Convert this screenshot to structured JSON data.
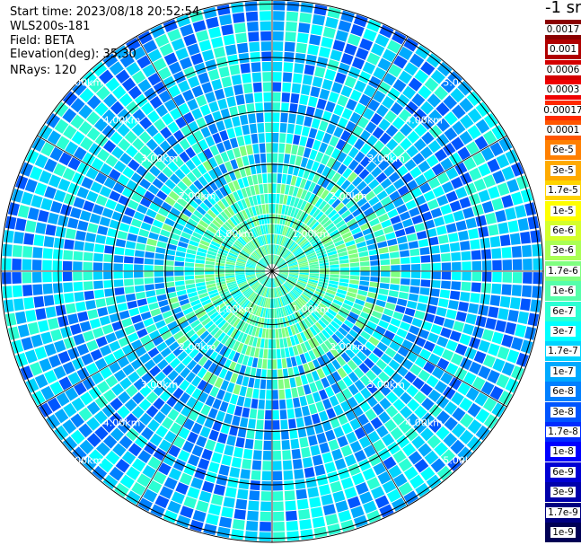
{
  "header": {
    "start_time": "Start time: 2023/08/18 20:52:54",
    "instrument": "WLS200s-181",
    "field": "Field: BETA",
    "elevation": "Elevation(deg): 35.30",
    "nrays": "NRays: 120"
  },
  "colorbar": {
    "unit": "-1 sr",
    "entries": [
      {
        "label": "0.0017",
        "color": "#8b0000",
        "text_color": "#000000"
      },
      {
        "label": "0.001",
        "color": "#b00000",
        "text_color": "#000000"
      },
      {
        "label": "0.0006",
        "color": "#d40000",
        "text_color": "#000000"
      },
      {
        "label": "0.0003",
        "color": "#f00000",
        "text_color": "#000000"
      },
      {
        "label": "0.00017",
        "color": "#ff2a00",
        "text_color": "#ffffff"
      },
      {
        "label": "0.0001",
        "color": "#ff5500",
        "text_color": "#000000"
      },
      {
        "label": "6e-5",
        "color": "#ff8000",
        "text_color": "#ffffff"
      },
      {
        "label": "3e-5",
        "color": "#ffaa00",
        "text_color": "#ffffff"
      },
      {
        "label": "1.7e-5",
        "color": "#ffd400",
        "text_color": "#000000"
      },
      {
        "label": "1e-5",
        "color": "#ffff00",
        "text_color": "#ffffff"
      },
      {
        "label": "6e-6",
        "color": "#d4ff2b",
        "text_color": "#000000"
      },
      {
        "label": "3e-6",
        "color": "#aaff55",
        "text_color": "#000000"
      },
      {
        "label": "1.7e-6",
        "color": "#80ff80",
        "text_color": "#000000"
      },
      {
        "label": "1e-6",
        "color": "#55ffaa",
        "text_color": "#ffffff"
      },
      {
        "label": "6e-7",
        "color": "#2bffd4",
        "text_color": "#000000"
      },
      {
        "label": "3e-7",
        "color": "#00ffff",
        "text_color": "#000000"
      },
      {
        "label": "1.7e-7",
        "color": "#00d4ff",
        "text_color": "#000000"
      },
      {
        "label": "1e-7",
        "color": "#00aaff",
        "text_color": "#ffffff"
      },
      {
        "label": "6e-8",
        "color": "#0080ff",
        "text_color": "#000000"
      },
      {
        "label": "3e-8",
        "color": "#0055ff",
        "text_color": "#000000"
      },
      {
        "label": "1.7e-8",
        "color": "#002bff",
        "text_color": "#ffffff"
      },
      {
        "label": "1e-8",
        "color": "#0000ff",
        "text_color": "#ffffff"
      },
      {
        "label": "6e-9",
        "color": "#0000d4",
        "text_color": "#ffffff"
      },
      {
        "label": "3e-9",
        "color": "#0000aa",
        "text_color": "#ffffff"
      },
      {
        "label": "1.7e-9",
        "color": "#000080",
        "text_color": "#ffffff"
      },
      {
        "label": "1e-9",
        "color": "#000055",
        "text_color": "#ffffff"
      }
    ]
  },
  "range_rings": {
    "labels": [
      "1.00km",
      "2.00km",
      "3.00km",
      "4.00km",
      "5.00km"
    ],
    "truncated_label": "5.0",
    "ring_color": "#000000",
    "label_color": "#ffffff"
  },
  "field_colors": {
    "dominant": [
      "#00d4ff",
      "#00aaff",
      "#0080ff",
      "#2bffd4",
      "#00ffff",
      "#0055ff"
    ],
    "near_center": [
      "#2bffd4",
      "#55ffaa",
      "#80ff80",
      "#00ffff"
    ],
    "ray_gap": "#ffffff"
  }
}
